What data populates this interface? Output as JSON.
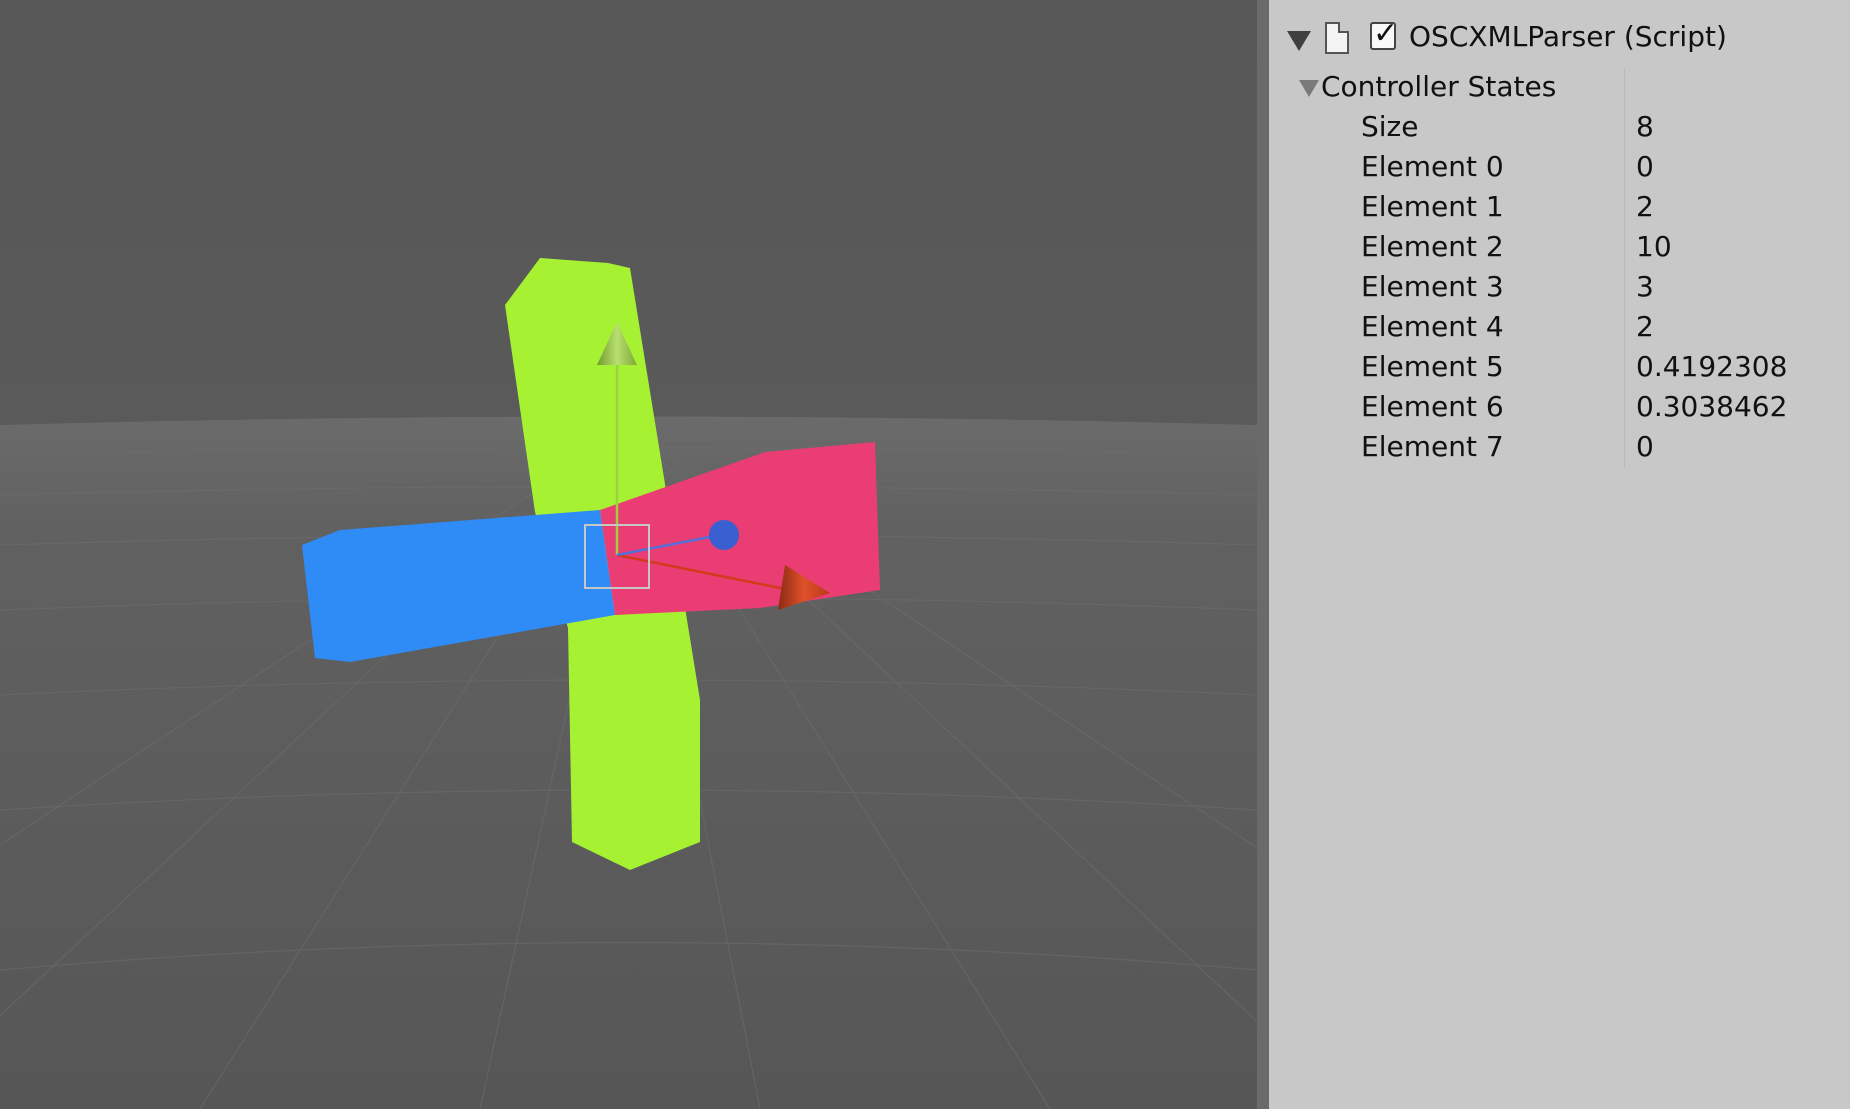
{
  "inspector": {
    "component_title": "OSCXMLParser (Script)",
    "component_enabled": true,
    "section_label": "Controller States",
    "rows": [
      {
        "label": "Size",
        "value": "8"
      },
      {
        "label": "Element 0",
        "value": "0"
      },
      {
        "label": "Element 1",
        "value": "2"
      },
      {
        "label": "Element 2",
        "value": "10"
      },
      {
        "label": "Element 3",
        "value": "3"
      },
      {
        "label": "Element 4",
        "value": "2"
      },
      {
        "label": "Element 5",
        "value": "0.4192308"
      },
      {
        "label": "Element 6",
        "value": "0.3038462"
      },
      {
        "label": "Element 7",
        "value": "0"
      }
    ]
  },
  "icons": {
    "foldout": "triangle-down-icon",
    "script": "document-icon",
    "enabled": "checkmark-icon"
  },
  "colors": {
    "viewport_bg": "#595959",
    "inspector_bg": "#c8c8c8",
    "bar_green": "#a6f232",
    "bar_blue": "#2f8cf7",
    "bar_pink": "#ea3d74",
    "gizmo_red": "#d2401e",
    "gizmo_blue": "#3a5fd0",
    "gizmo_green": "#9bd040"
  }
}
